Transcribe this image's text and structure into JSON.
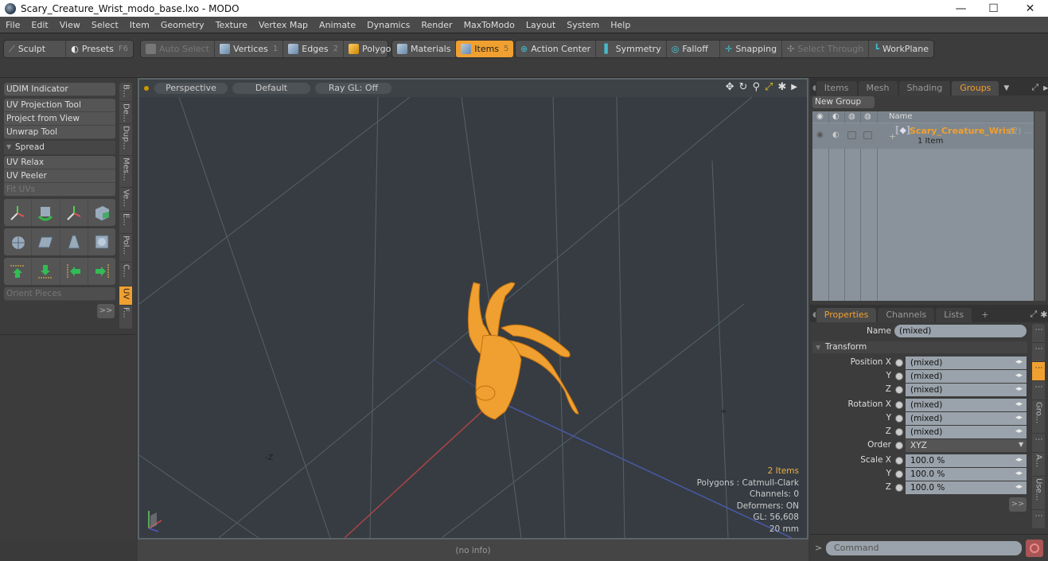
{
  "window": {
    "title": "Scary_Creature_Wrist_modo_base.lxo - MODO",
    "controls": {
      "minimize": "—",
      "maximize": "☐",
      "close": "✕"
    }
  },
  "menu": [
    "File",
    "Edit",
    "View",
    "Select",
    "Item",
    "Geometry",
    "Texture",
    "Vertex Map",
    "Animate",
    "Dynamics",
    "Render",
    "MaxToModo",
    "Layout",
    "System",
    "Help"
  ],
  "toolbar": {
    "sculpt": "Sculpt",
    "presets": "Presets",
    "presets_key": "F6",
    "auto_select": "Auto Select",
    "vertices": "Vertices",
    "vertices_key": "1",
    "edges": "Edges",
    "edges_key": "2",
    "polygons": "Polygons",
    "materials": "Materials",
    "items": "Items",
    "items_key": "5",
    "action_center": "Action Center",
    "symmetry": "Symmetry",
    "falloff": "Falloff",
    "snapping": "Snapping",
    "select_through": "Select Through",
    "workplane": "WorkPlane"
  },
  "left_panel": {
    "udim": "UDIM Indicator",
    "tools": [
      "UV Projection Tool",
      "Project from View",
      "Unwrap Tool"
    ],
    "spread": "Spread",
    "tools2": [
      "UV Relax",
      "UV Peeler",
      "Fit UVs"
    ],
    "orient": "Orient Pieces",
    "more": ">>",
    "vtabs": [
      "B...",
      "De...",
      "Dup...",
      "Mes...",
      "Ve...",
      "E...",
      "Pol...",
      "C...",
      "UV",
      "F..."
    ],
    "active_vtab": "UV"
  },
  "viewport": {
    "view": "Perspective",
    "shading": "Default",
    "raygl": "Ray GL: Off",
    "stats": {
      "items": "2 Items",
      "polygons": "Polygons : Catmull-Clark",
      "channels": "Channels: 0",
      "deformers": "Deformers: ON",
      "gl": "GL: 56,608",
      "scale": "20 mm"
    },
    "axis_label_neg_z": "-Z",
    "status": "(no info)"
  },
  "groups_panel": {
    "tabs": [
      "Items",
      "Mesh ...",
      "Shading",
      "Groups"
    ],
    "active_tab": "Groups",
    "new_group": "New Group",
    "col_name": "Name",
    "group_name": "Scary_Creature_Wrist",
    "group_count": "(2) ...",
    "group_sub": "1 Item"
  },
  "properties_panel": {
    "tabs": [
      "Properties",
      "Channels",
      "Lists",
      "+"
    ],
    "active_tab": "Properties",
    "name_label": "Name",
    "name_value": "(mixed)",
    "transform": "Transform",
    "rows": [
      {
        "label": "Position X",
        "value": "(mixed)"
      },
      {
        "label": "Y",
        "value": "(mixed)"
      },
      {
        "label": "Z",
        "value": "(mixed)"
      },
      {
        "label": "Rotation X",
        "value": "(mixed)"
      },
      {
        "label": "Y",
        "value": "(mixed)"
      },
      {
        "label": "Z",
        "value": "(mixed)"
      },
      {
        "label": "Order",
        "value": "XYZ"
      },
      {
        "label": "Scale X",
        "value": "100.0 %"
      },
      {
        "label": "Y",
        "value": "100.0 %"
      },
      {
        "label": "Z",
        "value": "100.0 %"
      }
    ],
    "more": ">>",
    "side_tabs": [
      "⋮",
      "⋮",
      "⋮",
      "⋮",
      "Gro...",
      "⋮",
      "A...",
      "Use...",
      "⋮"
    ]
  },
  "command": {
    "placeholder": "Command",
    "prompt": ">"
  },
  "colors": {
    "accent": "#f0a030",
    "viewport_bg": "#363c42",
    "mesh": "#f0a030"
  }
}
